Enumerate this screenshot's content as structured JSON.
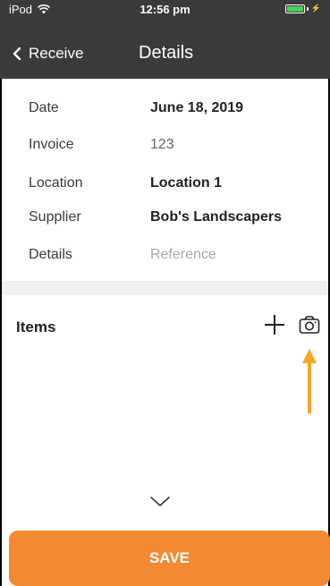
{
  "status_bar": {
    "carrier": "iPod",
    "time": "12:56 pm",
    "battery_level": 1.0,
    "battery_color": "#46d35a"
  },
  "nav": {
    "back_label": "Receive",
    "title": "Details"
  },
  "details": {
    "rows": [
      {
        "label": "Date",
        "value": "June 18, 2019"
      },
      {
        "label": "Invoice",
        "value": "123"
      },
      {
        "label": "Location",
        "value": "Location 1"
      },
      {
        "label": "Supplier",
        "value": "Bob's Landscapers"
      },
      {
        "label": "Details",
        "placeholder": "Reference"
      }
    ]
  },
  "items": {
    "title": "Items"
  },
  "footer": {
    "save_label": "SAVE"
  },
  "colors": {
    "header_bg": "#3a3a3a",
    "accent": "#f28a33"
  },
  "icons": [
    "wifi-icon",
    "battery-icon",
    "charging-bolt-icon",
    "back-chevron-icon",
    "plus-icon",
    "camera-icon",
    "annotation-arrow",
    "chevron-down-icon"
  ]
}
